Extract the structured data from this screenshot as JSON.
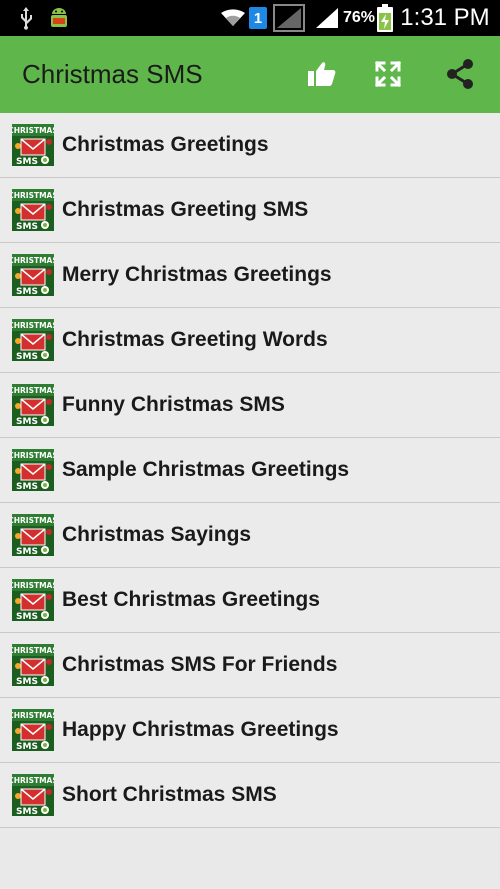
{
  "status_bar": {
    "battery_percent": "76%",
    "time": "1:31 PM",
    "notification_badge": "1",
    "icons": [
      "usb-icon",
      "android-debug-icon",
      "wifi-icon",
      "notification-badge-icon",
      "no-signal-icon",
      "signal-icon",
      "battery-charging-icon"
    ]
  },
  "action_bar": {
    "title": "Christmas SMS",
    "background": "#5fb64a",
    "actions": [
      {
        "name": "like",
        "icon": "thumbs-up-icon"
      },
      {
        "name": "fullscreen",
        "icon": "fullscreen-icon"
      },
      {
        "name": "share",
        "icon": "share-icon"
      }
    ]
  },
  "list": {
    "thumbnail_icon": "christmas-sms-icon",
    "items": [
      "Christmas Greetings",
      "Christmas Greeting SMS",
      "Merry Christmas Greetings",
      "Christmas Greeting Words",
      "Funny Christmas SMS",
      "Sample Christmas Greetings",
      "Christmas Sayings",
      "Best Christmas Greetings",
      "Christmas SMS For Friends",
      "Happy Christmas Greetings",
      "Short Christmas SMS"
    ]
  }
}
